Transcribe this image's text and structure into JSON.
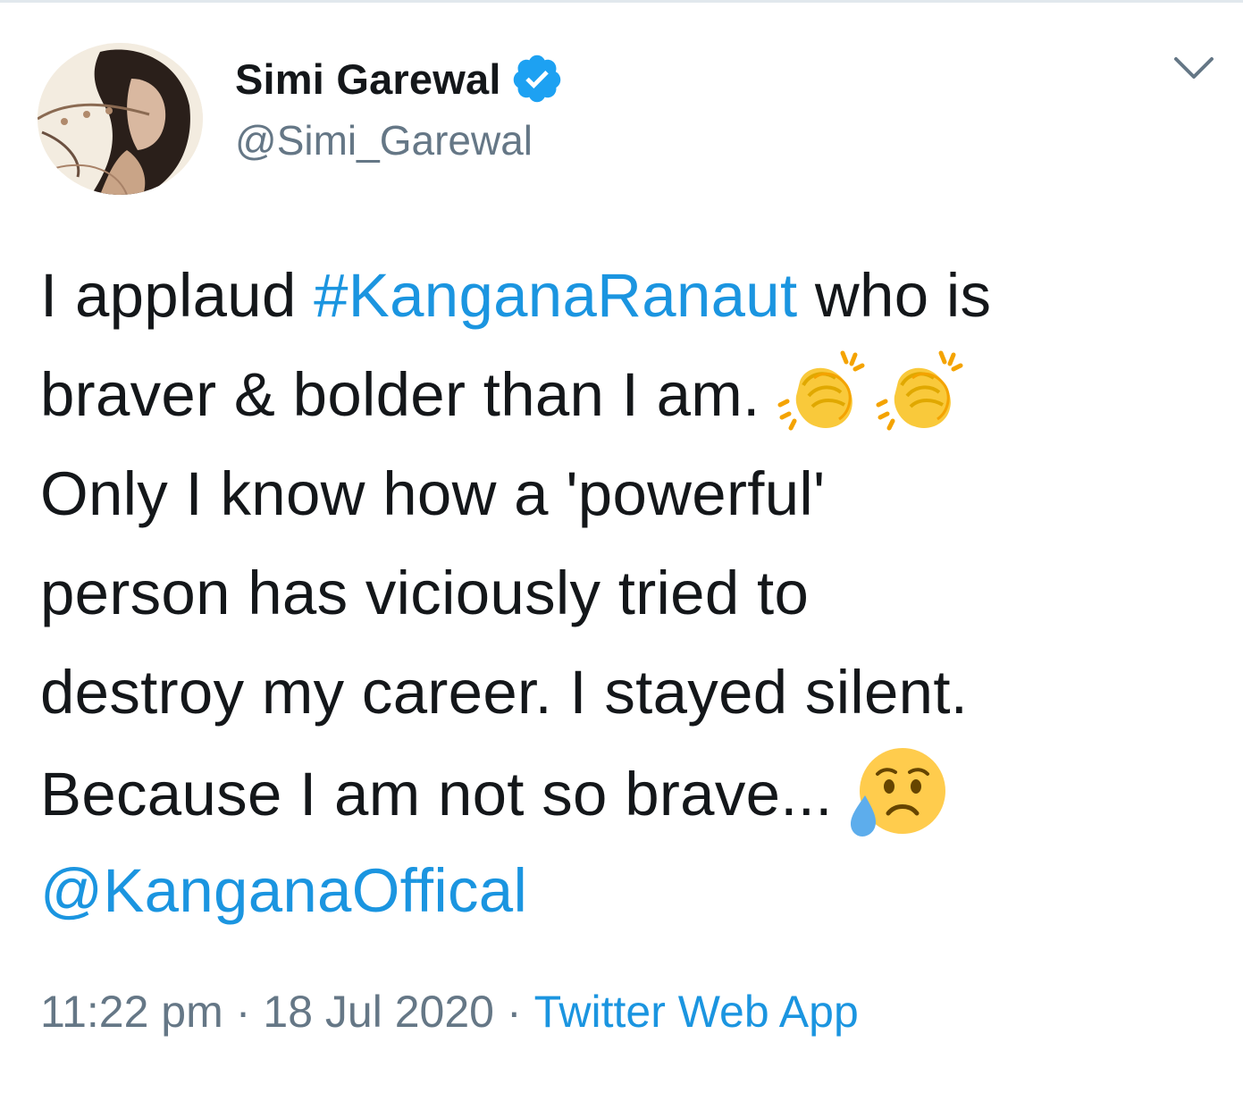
{
  "author": {
    "display_name": "Simi Garewal",
    "handle": "@Simi_Garewal",
    "verified": true
  },
  "tweet": {
    "lines": [
      {
        "before": "I applaud ",
        "hashtag": "#KanganaRanaut",
        "after": " who is"
      },
      {
        "text": "braver & bolder than I am.",
        "emojis": [
          "clapping-hands",
          "clapping-hands"
        ]
      },
      {
        "text": "Only I know how a 'powerful'"
      },
      {
        "text": "person has viciously tried to"
      },
      {
        "text": "destroy my career. I stayed silent."
      },
      {
        "text": "Because I am not so brave...",
        "emojis": [
          "sad-but-relieved-face"
        ]
      },
      {
        "mention": "@KanganaOffical"
      }
    ]
  },
  "meta": {
    "time": "11:22 pm",
    "separator": "·",
    "date": "18 Jul 2020",
    "source": "Twitter Web App"
  },
  "colors": {
    "link": "#1b95e0",
    "text": "#14171a",
    "muted": "#657786",
    "verified_badge": "#1da1f2"
  }
}
